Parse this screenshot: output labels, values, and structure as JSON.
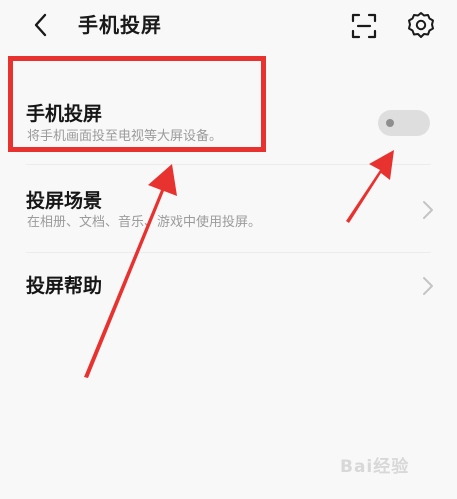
{
  "header": {
    "title": "手机投屏"
  },
  "rows": [
    {
      "title": "手机投屏",
      "desc": "将手机画面投至电视等大屏设备。"
    },
    {
      "title": "投屏场景",
      "desc": "在相册、文档、音乐、游戏中使用投屏。"
    },
    {
      "title": "投屏帮助"
    }
  ],
  "toggle": {
    "state": "off"
  },
  "watermark": "Bai经验",
  "icons": {
    "back": "back-icon",
    "scan": "scan-icon",
    "settings": "gear-icon",
    "chevron": "chevron-right-icon"
  },
  "colors": {
    "annotation": "#e8322f",
    "background": "#f9f8f8",
    "toggle_track": "#dedede"
  }
}
